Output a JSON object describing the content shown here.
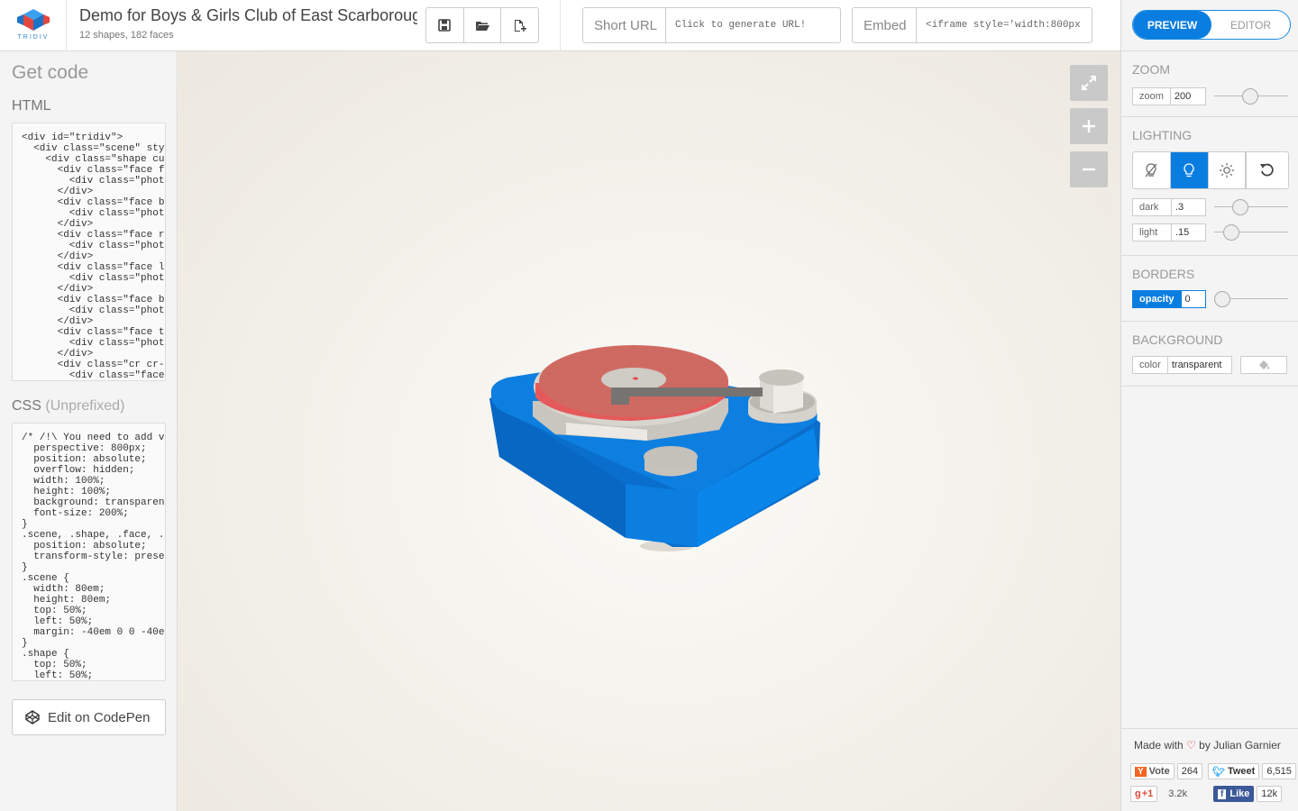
{
  "app": {
    "logo_text": "TRIDIV",
    "doc_title": "Demo for Boys & Girls Club of East Scarborough",
    "doc_stats": "12 shapes, 182 faces"
  },
  "toolbar": {
    "save_icon": "save-icon",
    "open_icon": "folder-open-icon",
    "new_icon": "new-file-icon"
  },
  "share": {
    "short_url_label": "Short URL",
    "short_url_value": "Click to generate URL!",
    "embed_label": "Embed",
    "embed_value": "<iframe style='width:800px"
  },
  "mode": {
    "preview": "PREVIEW",
    "editor": "EDITOR",
    "active": "preview"
  },
  "zoom": {
    "title": "ZOOM",
    "label": "zoom",
    "value": "200"
  },
  "lighting": {
    "title": "LIGHTING",
    "dark_label": "dark",
    "dark_value": ".3",
    "light_label": "light",
    "light_value": ".15",
    "active_mode": "bulb"
  },
  "borders": {
    "title": "BORDERS",
    "opacity_label": "opacity",
    "opacity_value": "0"
  },
  "background": {
    "title": "BACKGROUND",
    "color_label": "color",
    "color_value": "transparent"
  },
  "footer": {
    "made_with": "Made with",
    "by": "by Julian Garnier",
    "vote_label": "Vote",
    "vote_count": "264",
    "tweet_label": "Tweet",
    "tweet_count": "6,515",
    "gplus_label": "+1",
    "gplus_count": "3.2k",
    "like_label": "Like",
    "like_count": "12k"
  },
  "code_panel": {
    "title": "Get code",
    "html_heading": "HTML",
    "css_heading": "CSS",
    "css_subheading": "(Unprefixed)",
    "html_lines": [
      "<div id=\"tridiv\">",
      "  <div class=\"scene\" sty",
      "    <div class=\"shape cu",
      "      <div class=\"face f",
      "        <div class=\"phot",
      "      </div>",
      "      <div class=\"face b",
      "        <div class=\"phot",
      "      </div>",
      "      <div class=\"face r",
      "        <div class=\"phot",
      "      </div>",
      "      <div class=\"face l",
      "        <div class=\"phot",
      "      </div>",
      "      <div class=\"face b",
      "        <div class=\"phot",
      "      </div>",
      "      <div class=\"face t",
      "        <div class=\"phot",
      "      </div>",
      "      <div class=\"cr cr-",
      "        <div class=\"face"
    ],
    "css_lines": [
      "/* /!\\ You need to add v",
      "  perspective: 800px;",
      "  position: absolute;",
      "  overflow: hidden;",
      "  width: 100%;",
      "  height: 100%;",
      "  background: transparen",
      "  font-size: 200%;",
      "}",
      ".scene, .shape, .face, .",
      "  position: absolute;",
      "  transform-style: prese",
      "}",
      ".scene {",
      "  width: 80em;",
      "  height: 80em;",
      "  top: 50%;",
      "  left: 50%;",
      "  margin: -40em 0 0 -40e",
      "}",
      ".shape {",
      "  top: 50%;",
      "  left: 50%;"
    ],
    "codepen_label": "Edit on CodePen"
  },
  "viewport": {
    "fullscreen_icon": "expand-icon",
    "zoom_in_icon": "plus-icon",
    "zoom_out_icon": "minus-icon"
  },
  "colors": {
    "accent": "#0a7ee0",
    "turntable_base": "#0a7ad8",
    "record": "#d9605a",
    "metal": "#c8c4bd"
  }
}
